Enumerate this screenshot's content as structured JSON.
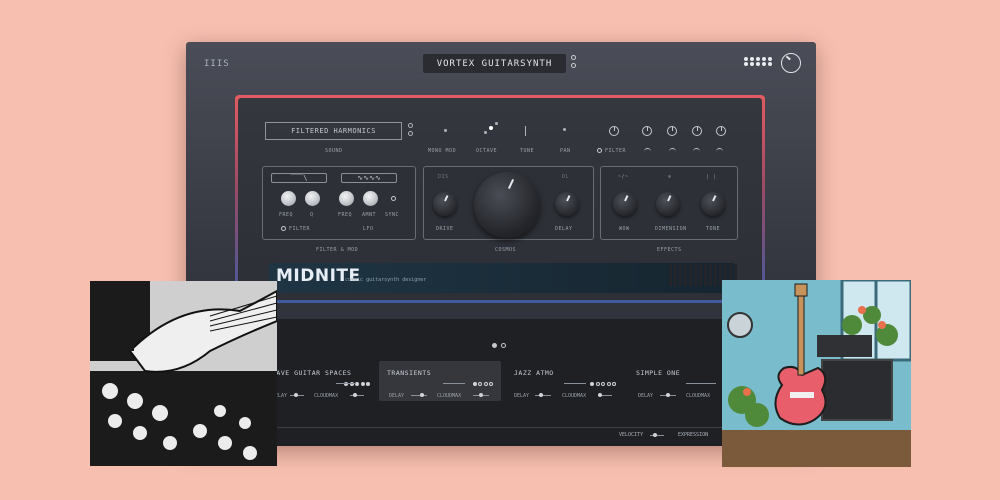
{
  "header": {
    "logo_text": "IIIS",
    "title": "VORTEX GUITARSYNTH"
  },
  "sound": {
    "preset_name": "FILTERED HARMONICS",
    "label": "SOUND"
  },
  "top_controls": {
    "mono_mode": "MONO MOD",
    "octave": "OCTAVE",
    "tune": "TUNE",
    "pan": "PAN",
    "filter": "FILTER"
  },
  "filter_mod": {
    "freq1": "FREQ",
    "q": "Q",
    "freq2": "FREQ",
    "amnt": "AMNT",
    "sync": "SYNC",
    "filter": "FILTER",
    "lfo": "LFO",
    "section": "FILTER & MOD"
  },
  "center": {
    "drive": "DRIVE",
    "delay": "DELAY",
    "cosmos": "COSMOS"
  },
  "effects": {
    "wow": "WOW",
    "dimension": "DIMENSION",
    "tone": "TONE",
    "section": "EFFECTS"
  },
  "brand": {
    "name": "MIDNITE",
    "tagline": "cosmic guitarsynth designer"
  },
  "presets": [
    {
      "name": "WAVE GUITAR SPACES",
      "meta1": "DELAY",
      "meta2": "CLOUDMAX"
    },
    {
      "name": "TRANSIENTS",
      "meta1": "DELAY",
      "meta2": "CLOUDMAX"
    },
    {
      "name": "JAZZ ATMO",
      "meta1": "DELAY",
      "meta2": "CLOUDMAX"
    },
    {
      "name": "SIMPLE ONE",
      "meta1": "DELAY",
      "meta2": "CLOUDMAX"
    }
  ],
  "footer": {
    "velocity": "VELOCITY",
    "expression": "EXPRESSION"
  }
}
